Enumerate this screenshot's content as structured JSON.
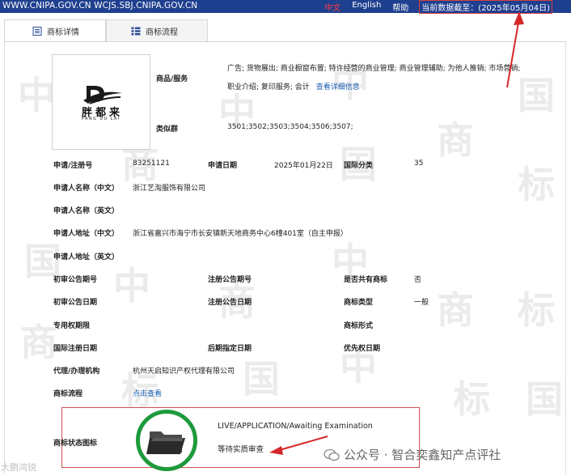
{
  "header": {
    "site": "WWW.CNIPA.GOV.CN WCJS.SBJ.CNIPA.GOV.CN",
    "lang_cn": "中文",
    "lang_en": "English",
    "help": "帮助",
    "date": "当前数据截至：(2025年05月04日)"
  },
  "tabs": {
    "detail": "商标详情",
    "flow": "商标流程"
  },
  "logo": {
    "text_cn": "胖都来",
    "text_en": "PANG DU LAI"
  },
  "goods": {
    "label": "商品/服务",
    "text": "广告; 货物展出; 商业橱窗布置; 特许经营的商业管理; 商业管理辅助; 为他人推销; 市场营销; 职业介绍; 复印服务; 会计",
    "link": "查看详细信息"
  },
  "similar": {
    "label": "类似群",
    "value": "3501;3502;3503;3504;3506;3507;"
  },
  "fields": {
    "reg_no_label": "申请/注册号",
    "reg_no": "83251121",
    "app_date_label": "申请日期",
    "app_date": "2025年01月22日",
    "intl_class_label": "国际分类",
    "intl_class": "35",
    "applicant_cn_label": "申请人名称（中文）",
    "applicant_cn": "浙江艺淘服饰有限公司",
    "applicant_en_label": "申请人名称（英文）",
    "address_cn_label": "申请人地址（中文）",
    "address_cn": "浙江省嘉兴市海宁市长安镇新天地商务中心6幢401室（自主申报）",
    "address_en_label": "申请人地址（英文）",
    "prelim_no_label": "初审公告期号",
    "reg_notice_no_label": "注册公告期号",
    "shared_label": "是否共有商标",
    "shared": "否",
    "prelim_date_label": "初审公告日期",
    "reg_notice_date_label": "注册公告日期",
    "type_label": "商标类型",
    "type": "一般",
    "right_period_label": "专用权期限",
    "form_label": "商标形式",
    "intl_reg_date_label": "国际注册日期",
    "later_date_label": "后期指定日期",
    "priority_date_label": "优先权日期",
    "agent_label": "代理/办理机构",
    "agent": "杭州天启知识产权代理有限公司",
    "flow_label": "商标流程",
    "flow_link": "点击查看",
    "status_label": "商标状态图标"
  },
  "status": {
    "en": "LIVE/APPLICATION/Awaiting Examination",
    "cn": "等待实质审查"
  },
  "watermark": {
    "wechat": "公众号 · 智合奕鑫知产点评社",
    "bottom_left": "大鹏鸿锐"
  },
  "watermark_chars": [
    "中",
    "国",
    "商",
    "标"
  ],
  "colors": {
    "topbar": "#1f3f8f",
    "link": "#1a5fb4",
    "status_ring": "#1e9a3d",
    "annotation": "#d62828"
  }
}
